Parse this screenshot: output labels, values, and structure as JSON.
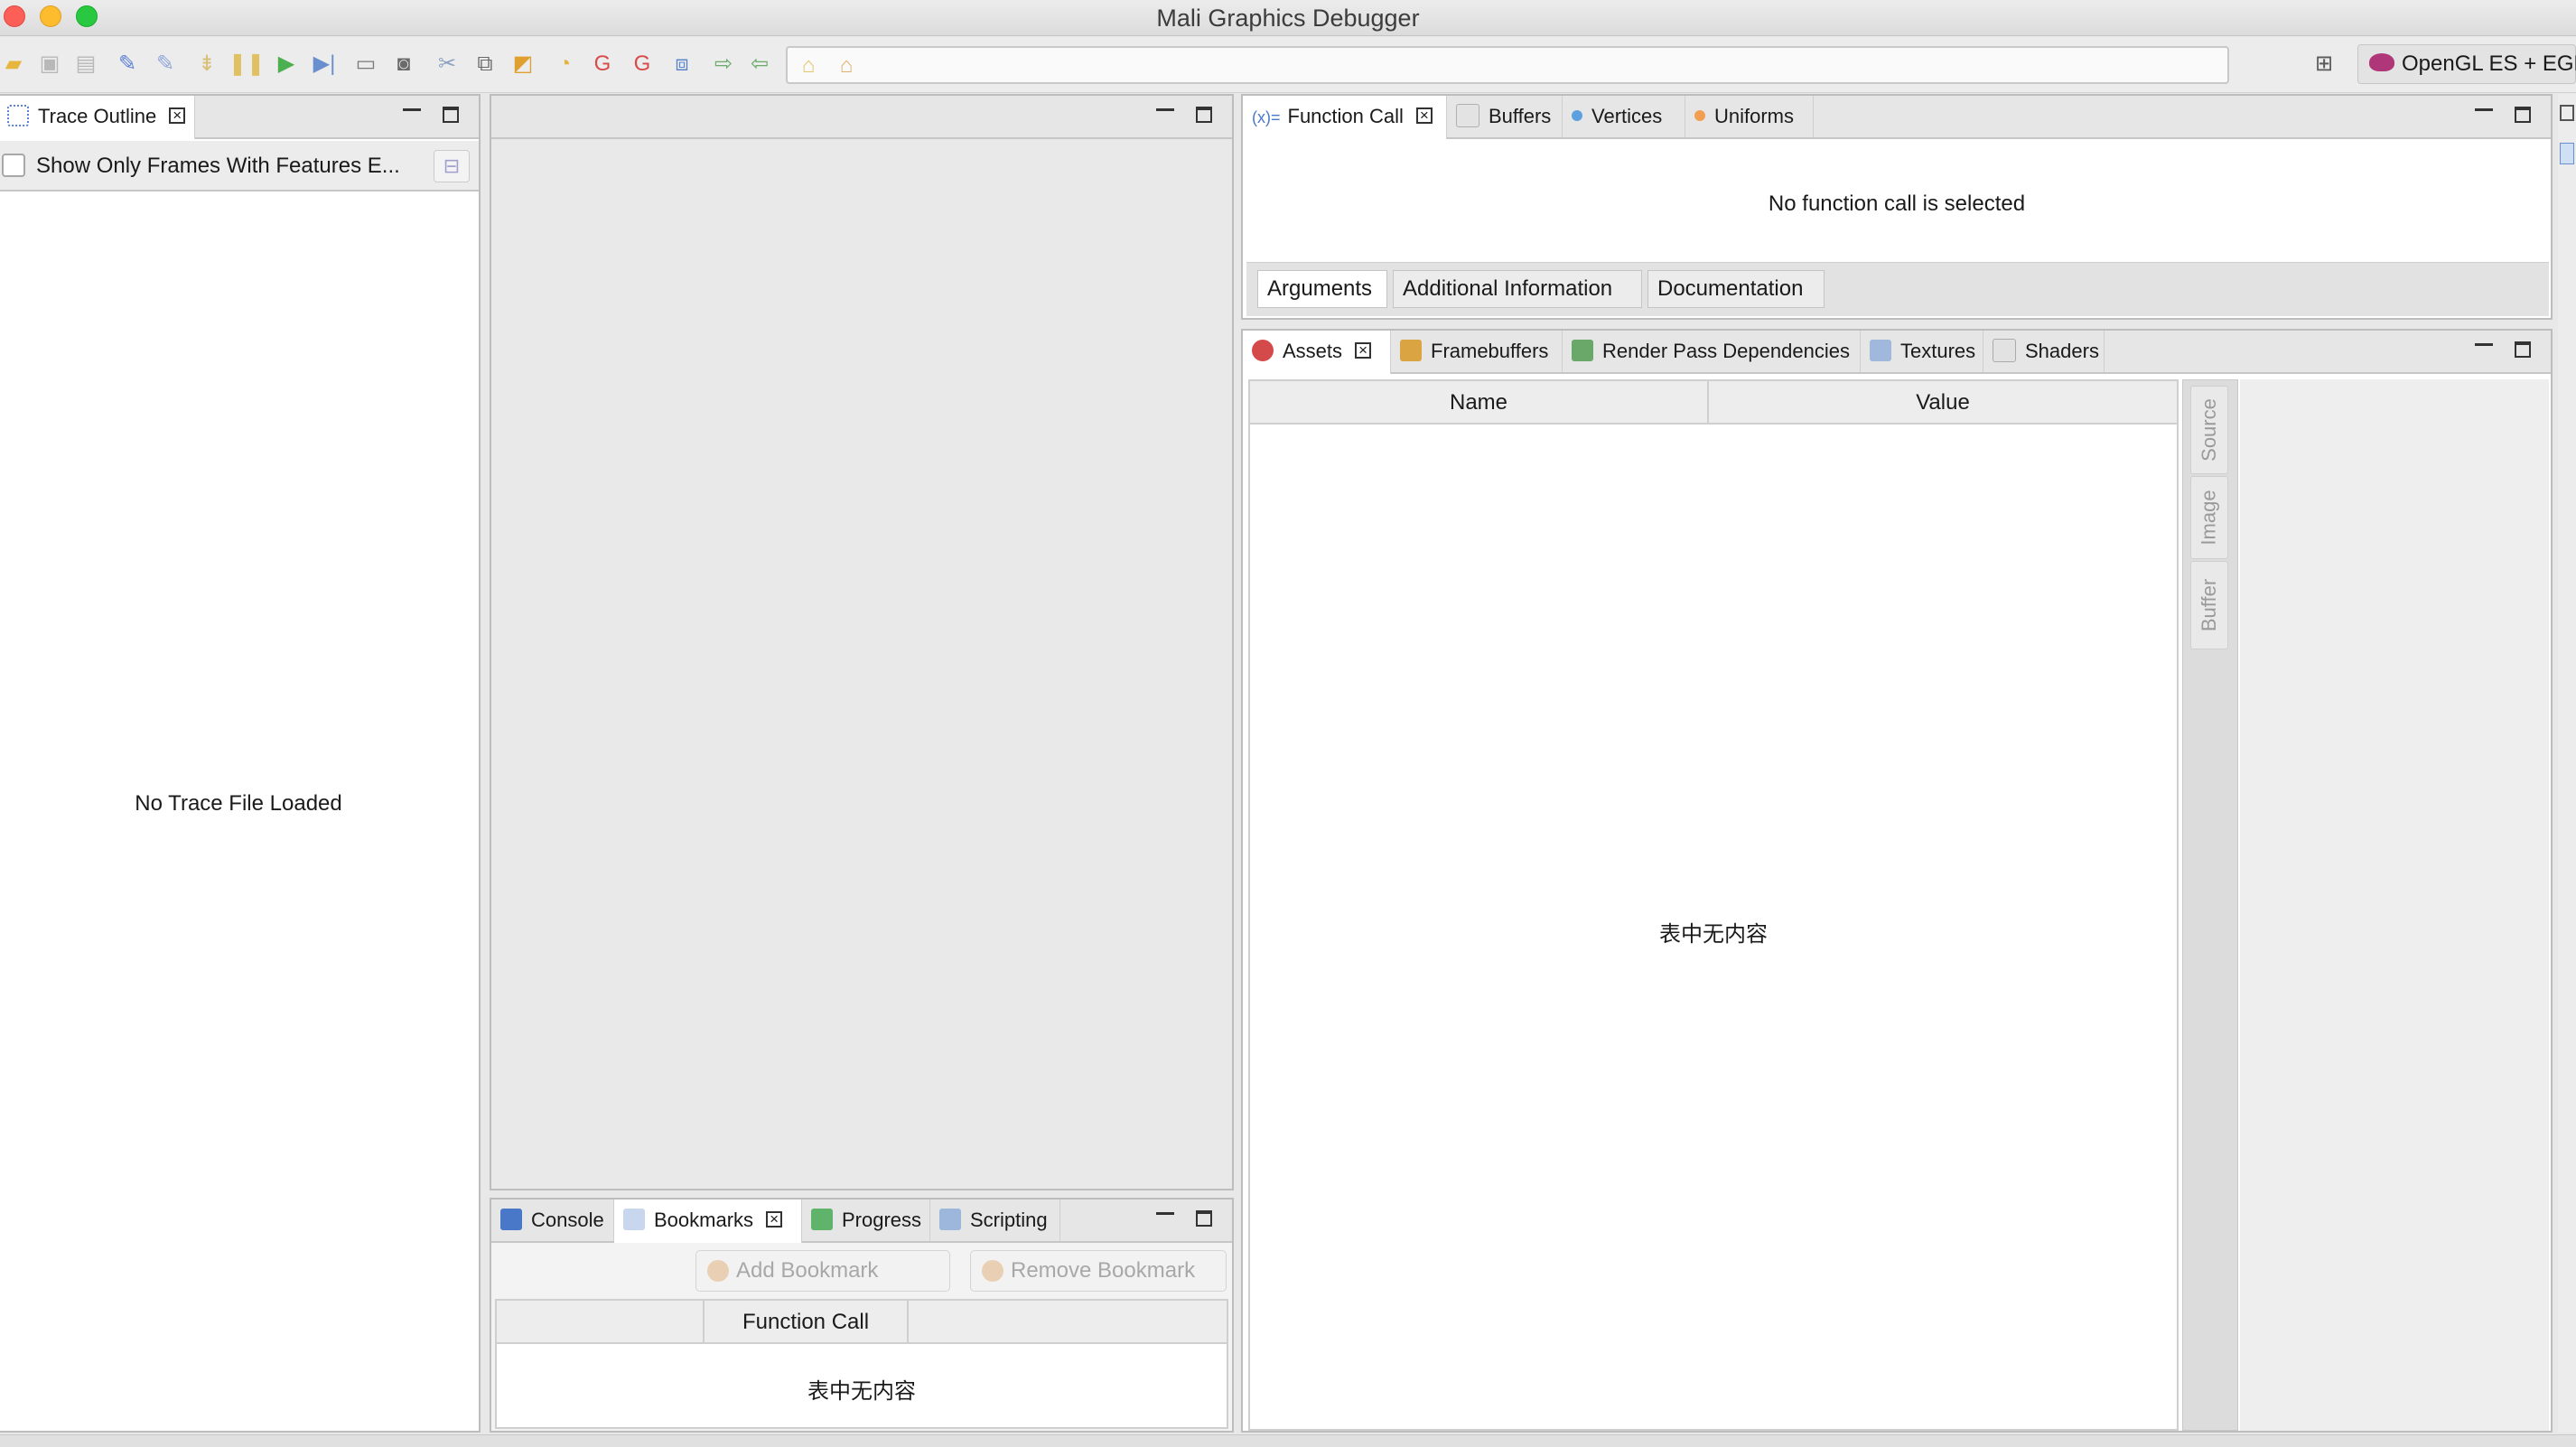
{
  "window": {
    "title": "Mali Graphics Debugger"
  },
  "toolbar": {
    "icons": [
      "open-folder-icon",
      "save-icon",
      "save-as-icon",
      "connect-icon",
      "disconnect-icon",
      "step-icon",
      "pause-icon",
      "play-icon",
      "step-over-icon",
      "capture-icon",
      "camera-icon",
      "overdraw-icon",
      "replay-icon",
      "fragment-icon",
      "shader-icon",
      "refresh-icon",
      "refresh-all-icon",
      "frame-icon",
      "forward-icon",
      "back-icon"
    ],
    "api_label": "OpenGL ES + EGL"
  },
  "trace_outline": {
    "tab_label": "Trace Outline",
    "filter_label": "Show Only Frames With Features E...",
    "empty_message": "No Trace File Loaded"
  },
  "bottom_panel": {
    "tabs": [
      {
        "label": "Console"
      },
      {
        "label": "Bookmarks"
      },
      {
        "label": "Progress"
      },
      {
        "label": "Scripting"
      }
    ],
    "add_bookmark": "Add Bookmark",
    "remove_bookmark": "Remove Bookmark",
    "column_header": "Function Call",
    "empty_message": "表中无内容"
  },
  "function_panel": {
    "tabs": [
      {
        "label": "Function Call"
      },
      {
        "label": "Buffers"
      },
      {
        "label": "Vertices"
      },
      {
        "label": "Uniforms"
      }
    ],
    "message": "No function call is selected",
    "subtabs": [
      "Arguments",
      "Additional Information",
      "Documentation"
    ]
  },
  "assets_panel": {
    "tabs": [
      {
        "label": "Assets"
      },
      {
        "label": "Framebuffers"
      },
      {
        "label": "Render Pass Dependencies"
      },
      {
        "label": "Textures"
      },
      {
        "label": "Shaders"
      }
    ],
    "columns": [
      "Name",
      "Value"
    ],
    "empty_message": "表中无内容",
    "side_tabs": [
      "Source",
      "Image",
      "Buffer"
    ]
  },
  "colors": {
    "accent_red": "#fc5f57",
    "accent_yellow": "#fdbc2e",
    "accent_green": "#28c840",
    "panel_border": "#bdbdbd",
    "api_teapot": "#b0367a"
  }
}
